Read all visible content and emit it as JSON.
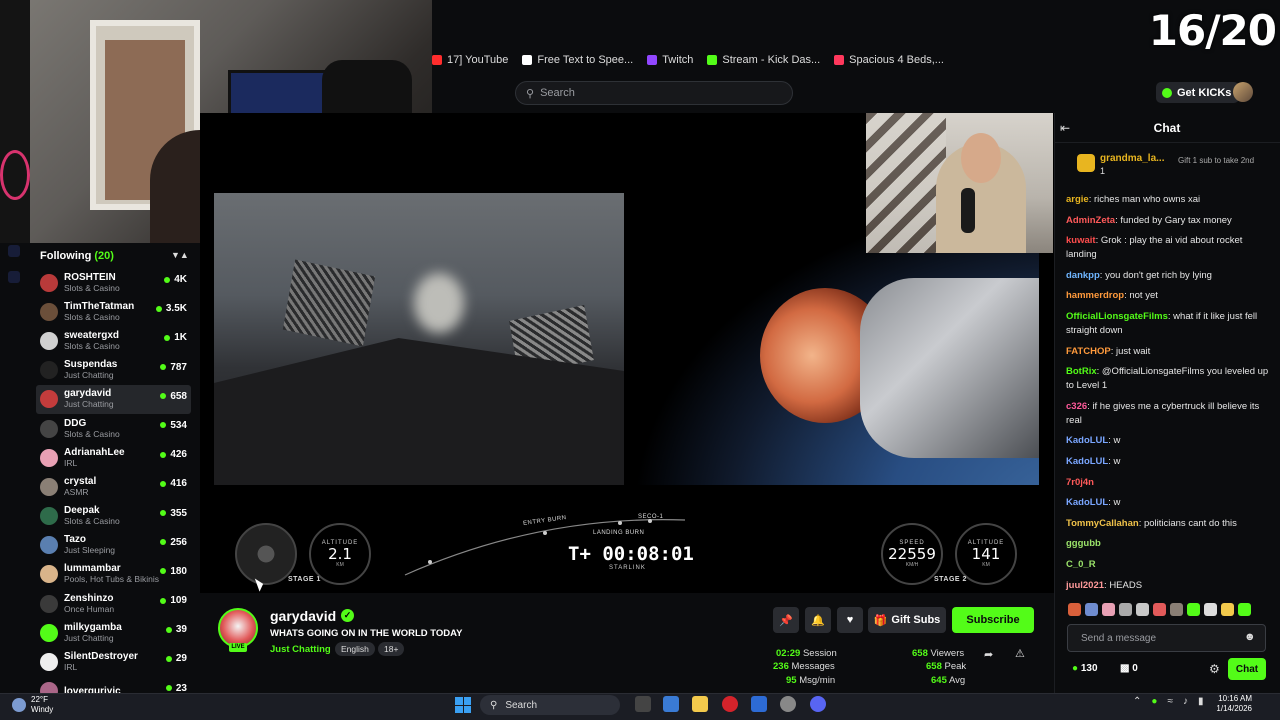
{
  "overlay": {
    "sub_goal": "16/20"
  },
  "bookmarks": [
    {
      "label": "17] YouTube",
      "color": "#ff2d2d"
    },
    {
      "label": "Free Text to Spee...",
      "color": "#ffffff"
    },
    {
      "label": "Twitch",
      "color": "#9146ff"
    },
    {
      "label": "Stream - Kick Das...",
      "color": "#53fc18"
    },
    {
      "label": "Spacious 4 Beds,...",
      "color": "#ff385c"
    }
  ],
  "header": {
    "search_placeholder": "Search",
    "get_kicks": "Get KICKs"
  },
  "following": {
    "label": "Following",
    "count": "(20)",
    "items": [
      {
        "name": "ROSHTEIN",
        "category": "Slots & Casino",
        "viewers": "4K",
        "color": "#b83a3a"
      },
      {
        "name": "TimTheTatman",
        "category": "Slots & Casino",
        "viewers": "3.5K",
        "color": "#6b4f3a"
      },
      {
        "name": "sweatergxd",
        "category": "Slots & Casino",
        "viewers": "1K",
        "color": "#d0d0d0"
      },
      {
        "name": "Suspendas",
        "category": "Just Chatting",
        "viewers": "787",
        "color": "#222222"
      },
      {
        "name": "garydavid",
        "category": "Just Chatting",
        "viewers": "658",
        "color": "#c43c3c"
      },
      {
        "name": "DDG",
        "category": "Slots & Casino",
        "viewers": "534",
        "color": "#444444"
      },
      {
        "name": "AdrianahLee",
        "category": "IRL",
        "viewers": "426",
        "color": "#e8a0b4"
      },
      {
        "name": "crystal",
        "category": "ASMR",
        "viewers": "416",
        "color": "#8a7f75"
      },
      {
        "name": "Deepak",
        "category": "Slots & Casino",
        "viewers": "355",
        "color": "#2e6b4a"
      },
      {
        "name": "Tazo",
        "category": "Just Sleeping",
        "viewers": "256",
        "color": "#5a7fb0"
      },
      {
        "name": "lummambar",
        "category": "Pools, Hot Tubs & Bikinis",
        "viewers": "180",
        "color": "#d9b48a"
      },
      {
        "name": "Zenshinzo",
        "category": "Once Human",
        "viewers": "109",
        "color": "#3a3a3a"
      },
      {
        "name": "milkygamba",
        "category": "Just Chatting",
        "viewers": "39",
        "color": "#53fc18"
      },
      {
        "name": "SilentDestroyer",
        "category": "IRL",
        "viewers": "29",
        "color": "#eeeeee"
      },
      {
        "name": "loverguriyic",
        "category": "",
        "viewers": "23",
        "color": "#aa6688"
      }
    ]
  },
  "hud": {
    "stage1": {
      "label": "STAGE 1",
      "alt_label": "ALTITUDE",
      "alt_value": "2.1",
      "alt_unit": "KM"
    },
    "stage2": {
      "label": "STAGE 2",
      "speed_label": "SPEED",
      "speed_value": "22559",
      "speed_unit": "KM/H",
      "alt_label": "ALTITUDE",
      "alt_value": "141",
      "alt_unit": "KM"
    },
    "timer": "T+ 00:08:01",
    "mission": "STARLINK",
    "events": [
      "ENTRY BURN",
      "LANDING BURN",
      "SECO-1"
    ]
  },
  "channel": {
    "name": "garydavid",
    "title": "WHATS GOING ON IN THE WORLD TODAY",
    "category": "Just Chatting",
    "tags": [
      "English",
      "18+"
    ],
    "live": "LIVE",
    "gift_subs": "Gift Subs",
    "subscribe": "Subscribe"
  },
  "stats": {
    "session_value": "02:29",
    "session_label": "Session",
    "messages_value": "236",
    "messages_label": "Messages",
    "msgmin_value": "95",
    "msgmin_label": "Msg/min",
    "viewers_value": "658",
    "viewers_label": "Viewers",
    "peak_value": "658",
    "peak_label": "Peak",
    "avg_value": "645",
    "avg_label": "Avg"
  },
  "chat": {
    "title": "Chat",
    "pinned": {
      "name": "grandma_la...",
      "num": "1",
      "gift_text": "Gift 1 sub to take 2nd"
    },
    "messages": [
      {
        "user": "argie",
        "text": "riches man who owns xai",
        "color": "#e8b520"
      },
      {
        "user": "AdminZeta",
        "text": "funded by Gary tax money",
        "color": "#ff5a5a"
      },
      {
        "user": "kuwait",
        "text": "Grok : play the ai vid about rocket landing",
        "color": "#ff4d4d"
      },
      {
        "user": "dankpp",
        "text": "you don't get rich by lying",
        "color": "#6fb6ff"
      },
      {
        "user": "hammerdrop",
        "text": "not yet",
        "color": "#ff9a3c"
      },
      {
        "user": "OfficialLionsgateFilms",
        "text": "what if it like just fell straight down",
        "color": "#53fc18"
      },
      {
        "user": "FATCHOP",
        "text": "just wait",
        "color": "#ff9a3c"
      },
      {
        "user": "BotRix",
        "text": "@OfficialLionsgateFilms you leveled up to Level 1",
        "color": "#53fc18"
      },
      {
        "user": "c326",
        "text": "if he gives me a cybertruck ill believe its real",
        "color": "#ff5a9a"
      },
      {
        "user": "KadoLUL",
        "text": "w",
        "color": "#7aa6ff"
      },
      {
        "user": "KadoLUL",
        "text": "w",
        "color": "#7aa6ff"
      },
      {
        "user": "7r0j4n",
        "text": "",
        "color": "#ff5a5a"
      },
      {
        "user": "KadoLUL",
        "text": "w",
        "color": "#7aa6ff"
      },
      {
        "user": "TommyCallahan",
        "text": "politicians cant do this",
        "color": "#f0c24a"
      },
      {
        "user": "gggubb",
        "text": "",
        "color": "#9be36a"
      },
      {
        "user": "C_0_R",
        "text": "",
        "color": "#9be36a"
      },
      {
        "user": "juul2021",
        "text": "HEADS",
        "color": "#ff9a9a"
      }
    ],
    "input_placeholder": "Send a message",
    "kicks_balance": "130",
    "sub_balance": "0",
    "send_label": "Chat"
  },
  "taskbar": {
    "temp": "22°F",
    "condition": "Windy",
    "search": "Search",
    "time": "10:16 AM",
    "date": "1/14/2026"
  }
}
